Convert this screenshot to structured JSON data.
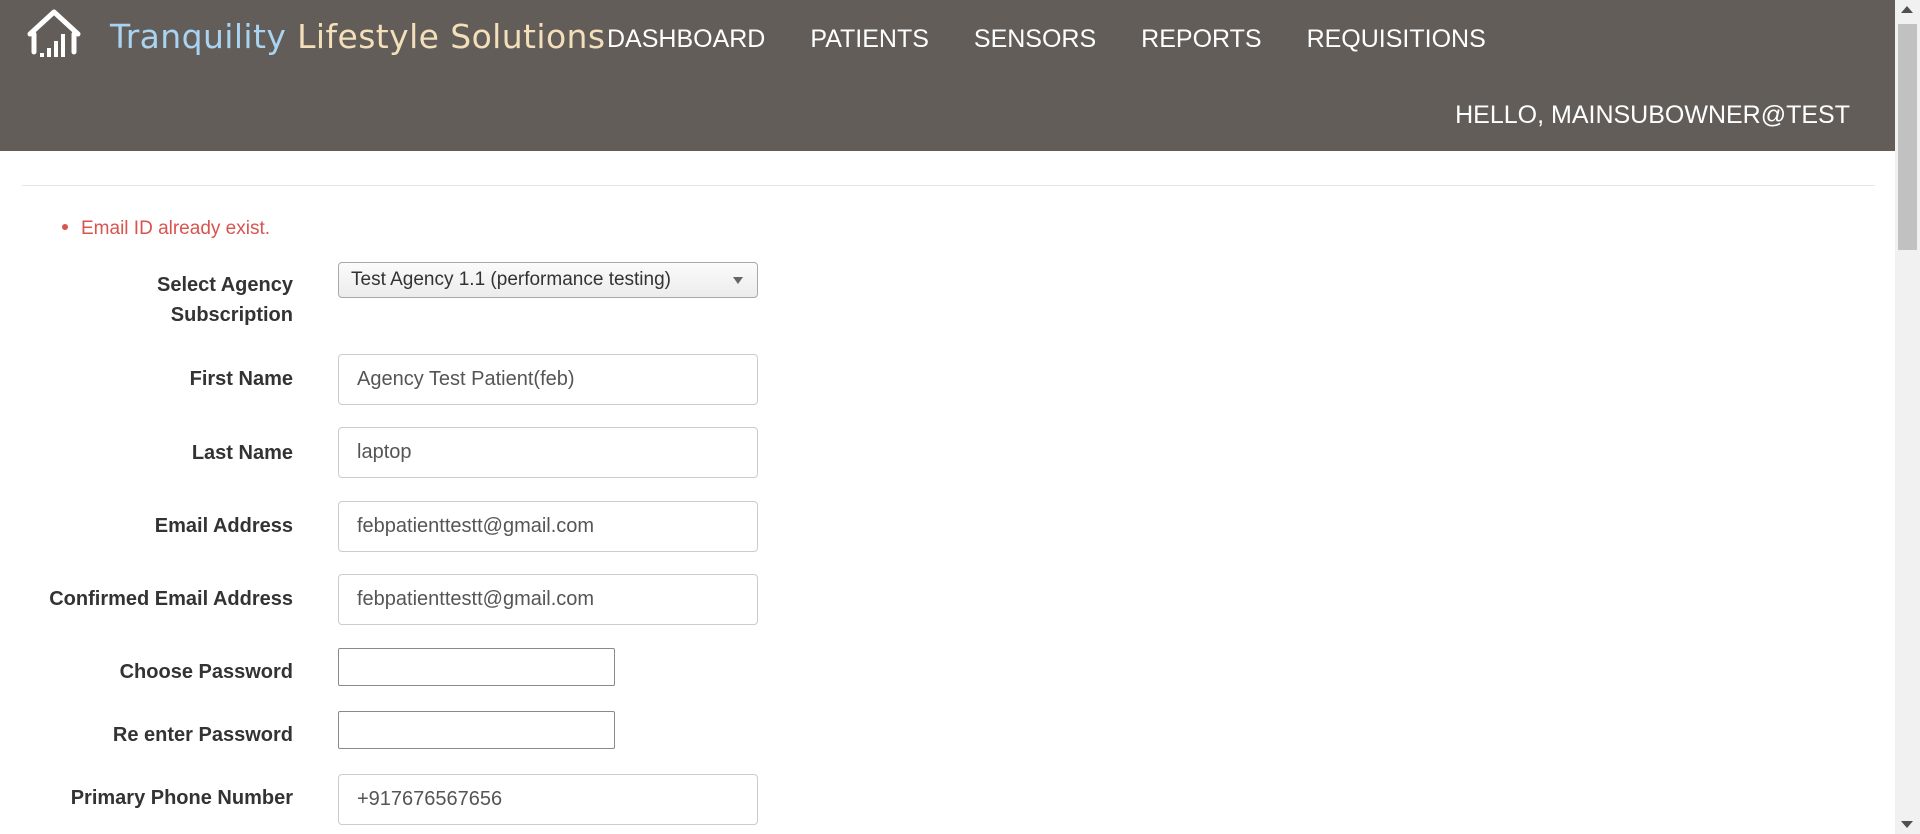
{
  "header": {
    "brand_part1": "Tranquility",
    "brand_part2": "Lifestyle Solutions",
    "logo_icon": "house-signal-icon",
    "nav": [
      {
        "label": "DASHBOARD"
      },
      {
        "label": "PATIENTS"
      },
      {
        "label": "SENSORS"
      },
      {
        "label": "REPORTS"
      },
      {
        "label": "REQUISITIONS"
      }
    ],
    "greeting": "HELLO, MAINSUBOWNER@TEST"
  },
  "errors": [
    "Email ID already exist."
  ],
  "form": {
    "agency": {
      "label_line1": "Select Agency",
      "label_line2": "Subscription",
      "value": "Test Agency 1.1 (performance testing)"
    },
    "first_name": {
      "label": "First Name",
      "value": "Agency Test Patient(feb)"
    },
    "last_name": {
      "label": "Last Name",
      "value": "laptop"
    },
    "email": {
      "label": "Email Address",
      "value": "febpatienttestt@gmail.com"
    },
    "confirm_email": {
      "label": "Confirmed Email Address",
      "value": "febpatienttestt@gmail.com"
    },
    "password": {
      "label": "Choose Password",
      "value": ""
    },
    "reenter_password": {
      "label": "Re enter Password",
      "value": ""
    },
    "phone": {
      "label": "Primary Phone Number",
      "value": "+917676567656"
    }
  },
  "colors": {
    "header_bg": "#625d58",
    "brand_part1": "#a9d3f0",
    "brand_part2": "#f3dfb9",
    "error": "#d9534f"
  }
}
